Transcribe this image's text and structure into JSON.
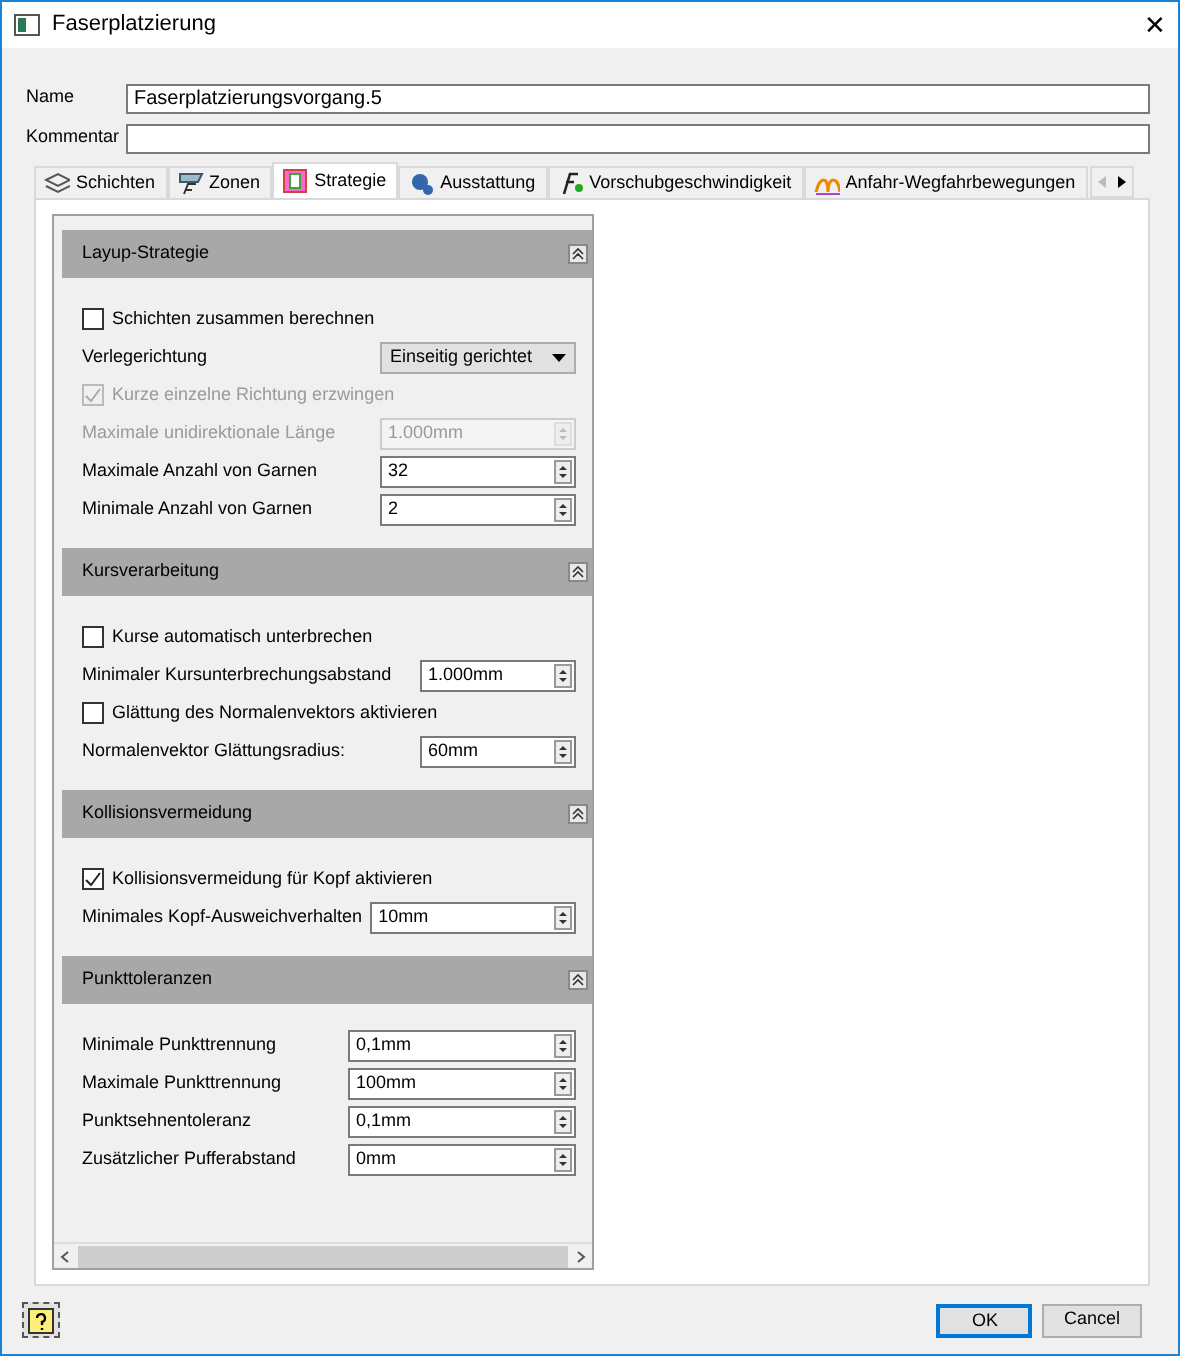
{
  "window": {
    "title": "Faserplatzierung",
    "close": "✕"
  },
  "fields": [
    {
      "label": "Name",
      "value": "Faserplatzierungsvorgang.5"
    },
    {
      "label": "Kommentar"
    }
  ],
  "tabs": [
    {
      "label": "Schichten",
      "selected": false
    },
    {
      "label": "Zonen",
      "selected": false
    },
    {
      "label": "Strategie",
      "selected": true
    },
    {
      "label": "Ausstattung",
      "selected": false
    },
    {
      "label": "Vorschubgeschwindigkeit",
      "selected": false
    },
    {
      "label": "Anfahr-Wegfahrbewegungen",
      "selected": false
    }
  ],
  "sections": [
    {
      "title": "Layup-Strategie",
      "expanded": true,
      "rows": [
        {
          "kind": "checkbox",
          "label": "Schichten zusammen berechnen",
          "checked": false,
          "disabled": false
        },
        {
          "kind": "select",
          "label": "Verlegerichtung",
          "value": "Einseitig gerichtet"
        },
        {
          "kind": "checkbox",
          "label": "Kurze einzelne Richtung erzwingen",
          "checked": true,
          "disabled": true
        },
        {
          "kind": "spin",
          "label": "Maximale unidirektionale Länge",
          "value": "1.000mm",
          "disabled": true
        },
        {
          "kind": "spin",
          "label": "Maximale Anzahl von Garnen",
          "value": "32",
          "disabled": false
        },
        {
          "kind": "spin",
          "label": "Minimale Anzahl von Garnen",
          "value": "2",
          "disabled": false
        }
      ]
    },
    {
      "title": "Kursverarbeitung",
      "expanded": true,
      "rows": [
        {
          "kind": "checkbox",
          "label": "Kurse automatisch unterbrechen",
          "checked": false,
          "disabled": false
        },
        {
          "kind": "spin",
          "label": "Minimaler Kursunterbrechungsabstand",
          "value": "1.000mm",
          "disabled": false
        },
        {
          "kind": "checkbox",
          "label": "Glättung des Normalenvektors aktivieren",
          "checked": false,
          "disabled": false
        },
        {
          "kind": "spin",
          "label": "Normalenvektor Glättungsradius:",
          "value": "60mm",
          "disabled": false
        }
      ]
    },
    {
      "title": "Kollisionsvermeidung",
      "expanded": true,
      "rows": [
        {
          "kind": "checkbox",
          "label": "Kollisionsvermeidung für Kopf aktivieren",
          "checked": true,
          "disabled": false
        },
        {
          "kind": "spin",
          "label": "Minimales Kopf-Ausweichverhalten",
          "value": "10mm",
          "disabled": false
        }
      ]
    },
    {
      "title": "Punkttoleranzen",
      "expanded": true,
      "rows": [
        {
          "kind": "spin",
          "label": "Minimale Punkttrennung",
          "value": "0,1mm",
          "disabled": false
        },
        {
          "kind": "spin",
          "label": "Maximale Punkttrennung",
          "value": "100mm",
          "disabled": false
        },
        {
          "kind": "spin",
          "label": "Punktsehnentoleranz",
          "value": "0,1mm",
          "disabled": false
        },
        {
          "kind": "spin",
          "label": "Zusätzlicher Pufferabstand",
          "value": "0mm",
          "disabled": false
        }
      ]
    }
  ],
  "buttons": [
    {
      "label": "OK",
      "default": true
    },
    {
      "label": "Cancel",
      "default": false
    }
  ]
}
